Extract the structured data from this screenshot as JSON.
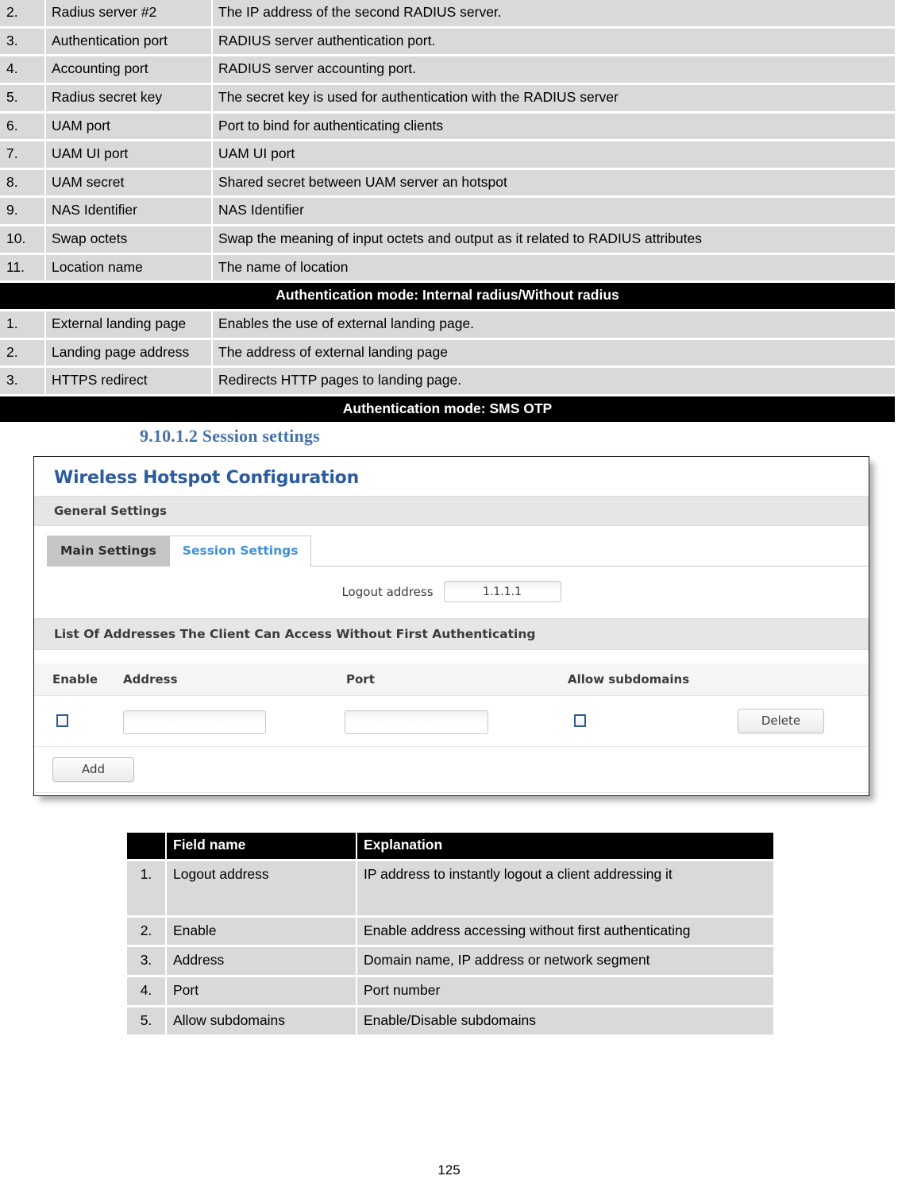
{
  "top_table": {
    "rows": [
      {
        "num": "2.",
        "field": "Radius server #2",
        "explanation": "The IP address of the second RADIUS server."
      },
      {
        "num": "3.",
        "field": "Authentication port",
        "explanation": "RADIUS server authentication port."
      },
      {
        "num": "4.",
        "field": "Accounting port",
        "explanation": "RADIUS server accounting port."
      },
      {
        "num": "5.",
        "field": "Radius secret key",
        "explanation": "The secret key is used for authentication with the RADIUS server"
      },
      {
        "num": "6.",
        "field": "UAM port",
        "explanation": "Port to bind for authenticating clients"
      },
      {
        "num": "7.",
        "field": "UAM UI port",
        "explanation": "UAM UI port"
      },
      {
        "num": "8.",
        "field": "UAM secret",
        "explanation": "Shared secret between UAM server an hotspot"
      },
      {
        "num": "9.",
        "field": "NAS Identifier",
        "explanation": "NAS Identifier"
      },
      {
        "num": "10.",
        "field": "Swap octets",
        "explanation": "Swap the meaning of input octets and output as it related to RADIUS attributes"
      },
      {
        "num": "11.",
        "field": "Location name",
        "explanation": "The name of location"
      }
    ]
  },
  "section_bar_internal": "Authentication mode: Internal radius/Without radius",
  "internal_table": {
    "rows": [
      {
        "num": "1.",
        "field": "External landing page",
        "explanation": "Enables the use of external landing page."
      },
      {
        "num": "2.",
        "field": "Landing page address",
        "explanation": "The address of external landing page"
      },
      {
        "num": "3.",
        "field": "HTTPS redirect",
        "explanation": "Redirects HTTP pages to landing page."
      }
    ]
  },
  "section_bar_sms": "Authentication mode:  SMS OTP",
  "heading": "9.10.1.2 Session settings",
  "screenshot": {
    "title": "Wireless Hotspot Configuration",
    "general_settings_bar": "General Settings",
    "tabs": [
      {
        "label": "Main Settings",
        "active": false
      },
      {
        "label": "Session Settings",
        "active": true
      }
    ],
    "logout_address": {
      "label": "Logout address",
      "value": "1.1.1.1"
    },
    "list_bar": "List Of Addresses The Client Can Access Without First Authenticating",
    "table_headers": [
      "Enable",
      "Address",
      "Port",
      "Allow subdomains"
    ],
    "row": {
      "enable_checked": false,
      "address_value": "",
      "port_value": "",
      "allow_subdomains_checked": false,
      "delete_label": "Delete"
    },
    "add_label": "Add",
    "colors": {
      "title_blue": "#2c5c9e",
      "active_tab_blue": "#3e91d8",
      "checkbox_border": "#2f5d91"
    }
  },
  "bottom_table": {
    "headers": [
      "",
      "Field name",
      "Explanation"
    ],
    "rows": [
      {
        "num": "1.",
        "field": "Logout address",
        "explanation": "IP address to instantly logout a client addressing it"
      },
      {
        "num": "2.",
        "field": "Enable",
        "explanation": "Enable address accessing without first authenticating"
      },
      {
        "num": "3.",
        "field": "Address",
        "explanation": "Domain name, IP address or network segment"
      },
      {
        "num": "4.",
        "field": "Port",
        "explanation": "Port number"
      },
      {
        "num": "5.",
        "field": "Allow subdomains",
        "explanation": "Enable/Disable subdomains"
      }
    ]
  },
  "page_number": "125"
}
